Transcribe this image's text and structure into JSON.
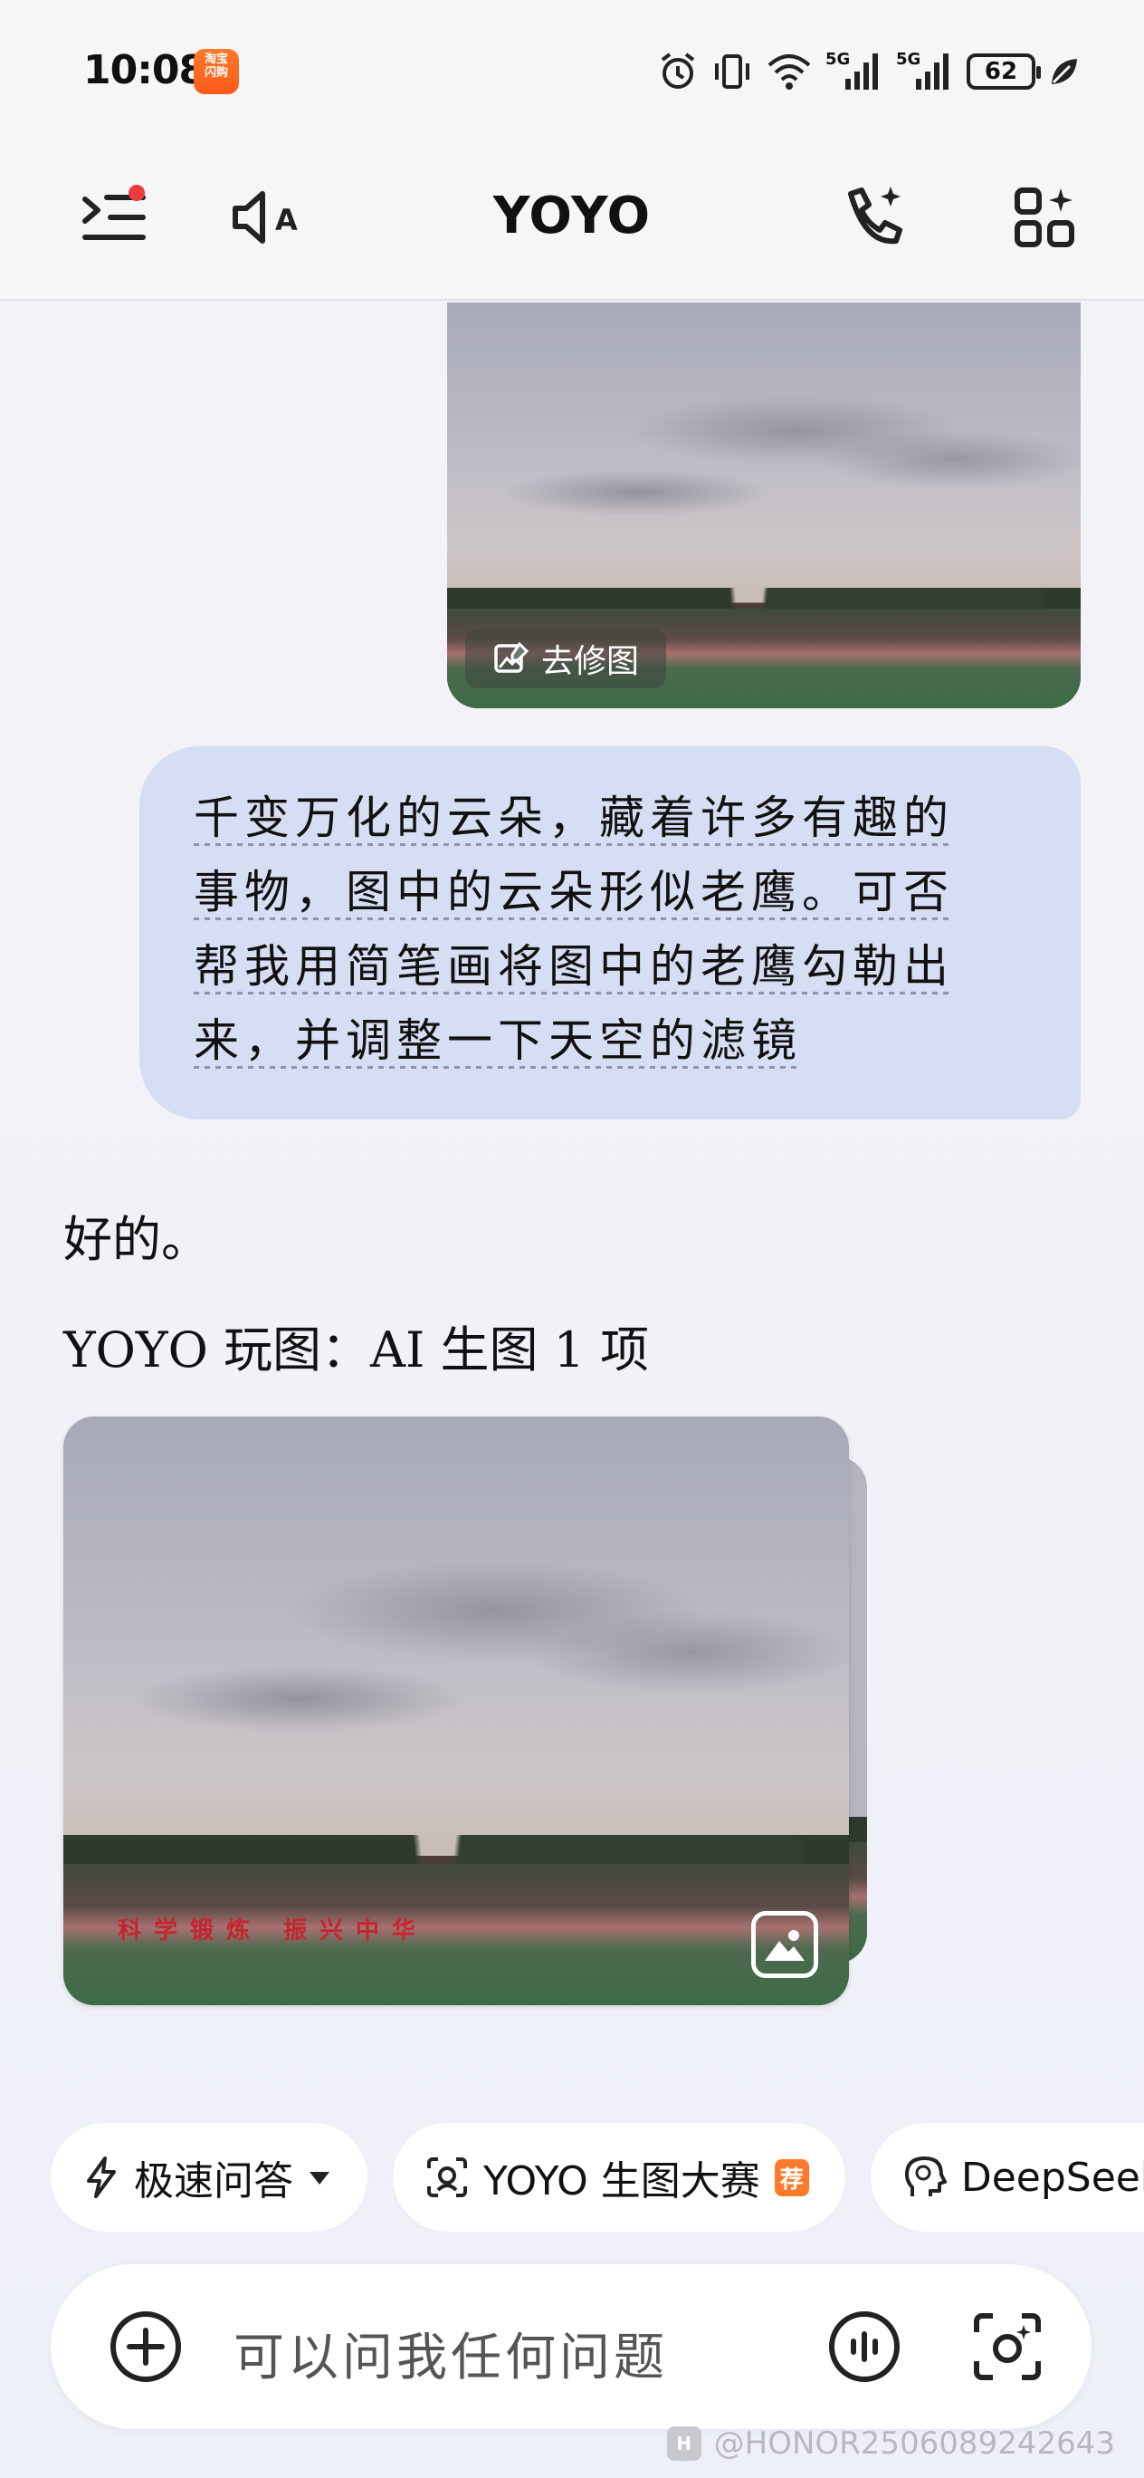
{
  "status_bar": {
    "time": "10:08",
    "app_badge": "淘宝\n闪购",
    "network_1": "5G",
    "network_2": "5G",
    "battery": "62"
  },
  "header": {
    "title": "YOYO"
  },
  "chat": {
    "top_image_action": "去修图",
    "user_message_lines": [
      "千变万化的云朵，藏着许多有趣的",
      "事物，图中的云朵形似老鹰。可否",
      "帮我用简笔画将图中的老鹰勾勒出",
      "来，并调整一下天空的滤镜"
    ],
    "reply_ok": "好的。",
    "reply_summary": "YOYO 玩图：AI 生图 1 项",
    "banner_text": "科学锻炼 振兴中华"
  },
  "chips": {
    "fast_qa": "极速问答",
    "contest": "YOYO 生图大赛",
    "contest_tag": "荐",
    "deepseek": "DeepSeek-V"
  },
  "input": {
    "placeholder": "可以问我任何问题"
  },
  "watermark": {
    "logo": "H",
    "text": "@HONOR2506089242643"
  }
}
